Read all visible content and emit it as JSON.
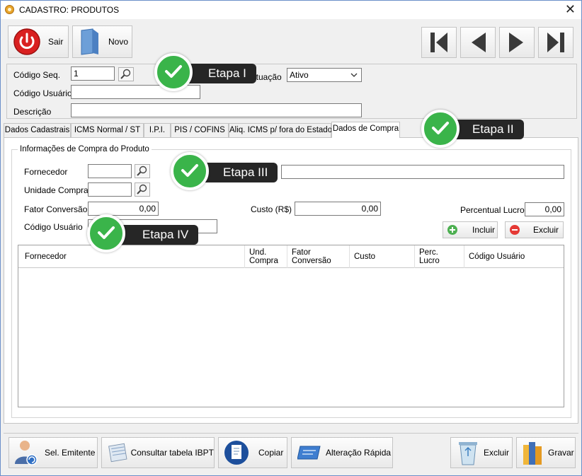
{
  "window": {
    "title": "CADASTRO: PRODUTOS"
  },
  "toolbar": {
    "sair": "Sair",
    "novo": "Novo"
  },
  "header_form": {
    "codigo_seq_label": "Código Seq.",
    "codigo_seq_value": "1",
    "situacao_label": "Situação",
    "situacao_value": "Ativo",
    "codigo_usuario_label": "Código Usuário",
    "codigo_usuario_value": "",
    "descricao_label": "Descrição",
    "descricao_value": ""
  },
  "tabs": [
    "Dados Cadastrais",
    "ICMS Normal / ST",
    "I.P.I.",
    "PIS / COFINS",
    "Aliq. ICMS p/ fora do Estado",
    "Dados de Compra"
  ],
  "compra": {
    "group_title": "Informações de Compra do Produto",
    "fornecedor_label": "Fornecedor",
    "fornecedor_value": "",
    "fornecedor_nome": "",
    "unidade_label": "Unidade Compra",
    "unidade_value": "",
    "fator_label": "Fator Conversão",
    "fator_value": "0,00",
    "custo_label": "Custo (R$)",
    "custo_value": "0,00",
    "percentual_label": "Percentual Lucro",
    "percentual_value": "0,00",
    "codigo_usuario_label": "Código Usuário",
    "codigo_usuario_value": "",
    "incluir": "Incluir",
    "excluir": "Excluir"
  },
  "grid": {
    "columns": [
      "Fornecedor",
      "Und. Compra",
      "Fator Conversão",
      "Custo",
      "Perc. Lucro",
      "Código Usuário"
    ]
  },
  "bottom": {
    "sel_emitente": "Sel. Emitente",
    "consultar": "Consultar tabela IBPT",
    "copiar": "Copiar",
    "alteracao": "Alteração Rápida",
    "excluir": "Excluir",
    "gravar": "Gravar"
  },
  "callouts": {
    "etapa1": "Etapa I",
    "etapa2": "Etapa II",
    "etapa3": "Etapa III",
    "etapa4": "Etapa IV"
  },
  "colors": {
    "check_green": "#3ab44a",
    "callout_bg": "#262626"
  }
}
